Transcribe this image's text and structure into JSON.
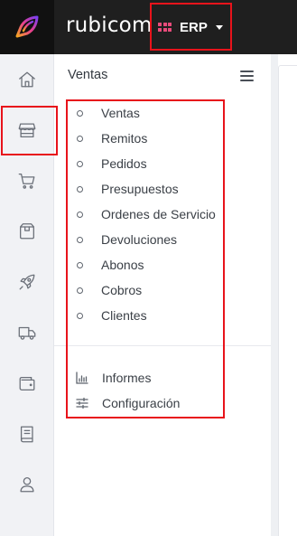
{
  "header": {
    "brand": "rubicom",
    "module_label": "ERP"
  },
  "rail": {
    "items": [
      {
        "icon": "home-icon",
        "label": "Inicio"
      },
      {
        "icon": "store-icon",
        "label": "Ventas"
      },
      {
        "icon": "cart-icon",
        "label": "Compras"
      },
      {
        "icon": "box-icon",
        "label": "Productos"
      },
      {
        "icon": "rocket-icon",
        "label": "Proyectos"
      },
      {
        "icon": "truck-icon",
        "label": "Logistica"
      },
      {
        "icon": "wallet-icon",
        "label": "Tesoreria"
      },
      {
        "icon": "book-icon",
        "label": "Contabilidad"
      },
      {
        "icon": "user-icon",
        "label": "Usuarios"
      }
    ]
  },
  "panel": {
    "title": "Ventas",
    "items": [
      {
        "label": "Ventas"
      },
      {
        "label": "Remitos"
      },
      {
        "label": "Pedidos"
      },
      {
        "label": "Presupuestos"
      },
      {
        "label": "Ordenes de Servicio"
      },
      {
        "label": "Devoluciones"
      },
      {
        "label": "Abonos"
      },
      {
        "label": "Cobros"
      },
      {
        "label": "Clientes"
      }
    ],
    "tools": [
      {
        "label": "Informes",
        "icon": "bar-chart-icon"
      },
      {
        "label": "Configuración",
        "icon": "sliders-icon"
      }
    ]
  },
  "colors": {
    "topbar": "#1f1f1f",
    "erp_grid": "#e94b7b",
    "highlight": "#e8131b",
    "rail_bg": "#f1f2f5"
  }
}
